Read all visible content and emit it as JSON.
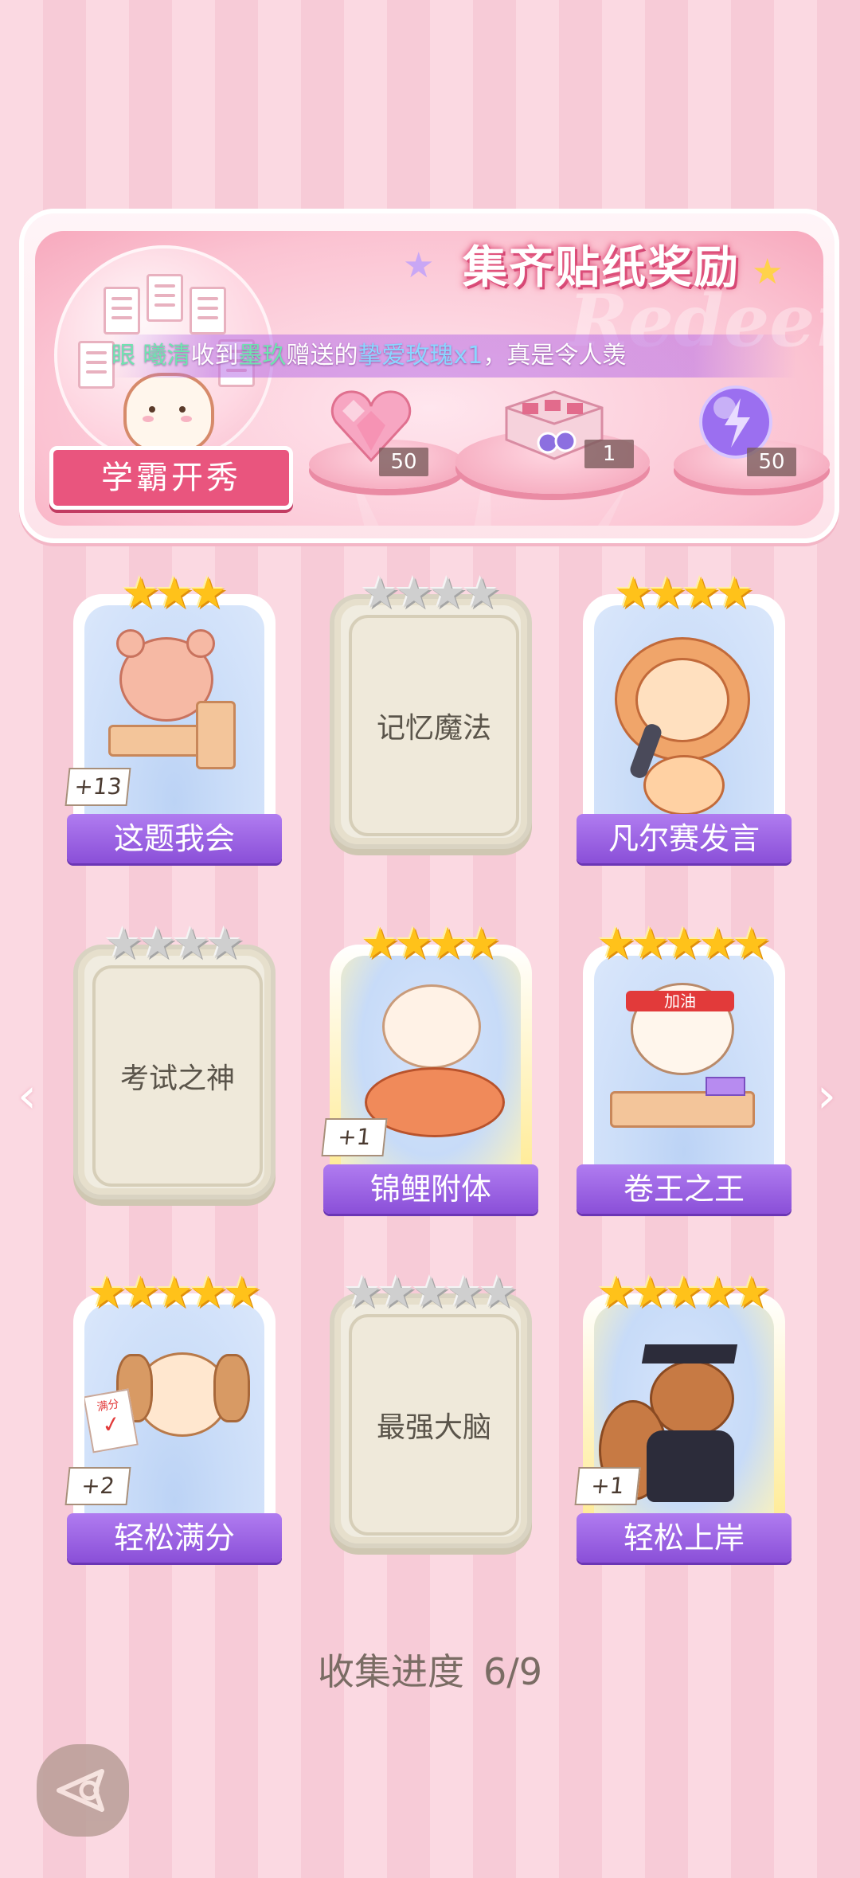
{
  "banner": {
    "title": "集齐贴纸奖励",
    "watermark": "Redeem",
    "marquee": {
      "user1": "眼 曦清",
      "text1": "收到",
      "user2": "墨玖",
      "text2": "赠送的",
      "gift": "挚爱玫瑰x1",
      "text3": "，真是令人羡"
    },
    "collection_name": "学霸开秀",
    "rewards": [
      {
        "icon": "pink-heart-gem-icon",
        "count": "50"
      },
      {
        "icon": "gift-box-icon",
        "count": "1"
      },
      {
        "icon": "purple-lightning-orb-icon",
        "count": "50"
      }
    ]
  },
  "cards": [
    {
      "name": "这题我会",
      "collected": true,
      "stars": 3,
      "max_stars": 3,
      "duplicates": "+13",
      "mascot": "bear-at-desk"
    },
    {
      "name": "记忆魔法",
      "collected": false,
      "stars": 0,
      "max_stars": 4,
      "duplicates": "",
      "mascot": ""
    },
    {
      "name": "凡尔赛发言",
      "collected": true,
      "stars": 4,
      "max_stars": 4,
      "duplicates": "",
      "mascot": "lion-with-microphone"
    },
    {
      "name": "考试之神",
      "collected": false,
      "stars": 0,
      "max_stars": 4,
      "duplicates": "",
      "mascot": ""
    },
    {
      "name": "锦鲤附体",
      "collected": true,
      "stars": 4,
      "max_stars": 4,
      "duplicates": "+1",
      "mascot": "bear-holding-koi"
    },
    {
      "name": "卷王之王",
      "collected": true,
      "stars": 5,
      "max_stars": 5,
      "duplicates": "",
      "mascot": "cat-with-headband",
      "headband_text": "加油"
    },
    {
      "name": "轻松满分",
      "collected": true,
      "stars": 5,
      "max_stars": 5,
      "duplicates": "+2",
      "mascot": "puppy-with-test",
      "paper_text": "满分"
    },
    {
      "name": "最强大脑",
      "collected": false,
      "stars": 0,
      "max_stars": 5,
      "duplicates": "",
      "mascot": ""
    },
    {
      "name": "轻松上岸",
      "collected": true,
      "stars": 5,
      "max_stars": 5,
      "duplicates": "+1",
      "mascot": "squirrel-graduate"
    }
  ],
  "progress": {
    "label": "收集进度",
    "value": "6/9"
  },
  "colors": {
    "accent": "#8a4fd8",
    "banner_pink": "#e9557e",
    "star_gold": "#ffc21a"
  }
}
